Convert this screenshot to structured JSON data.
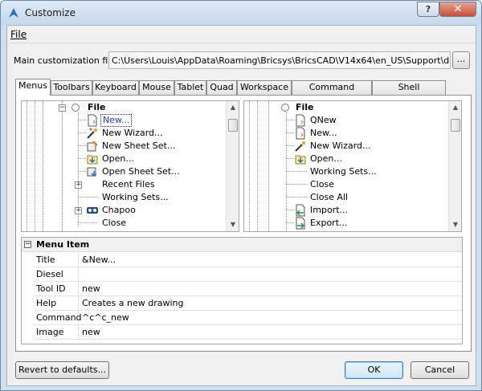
{
  "window": {
    "title": "Customize",
    "help": "?",
    "close": "✕"
  },
  "menubar": {
    "file": "File"
  },
  "main_file": {
    "label": "Main customization file:",
    "value": "C:\\Users\\Louis\\AppData\\Roaming\\Bricsys\\BricsCAD\\V14x64\\en_US\\Support\\default.cui",
    "browse": "..."
  },
  "tabs": [
    "Menus",
    "Toolbars",
    "Keyboard",
    "Mouse",
    "Tablet",
    "Quad",
    "Workspace",
    "Command Aliases",
    "Shell Commands"
  ],
  "left_tree": {
    "root": "File",
    "items": [
      "New...",
      "New Wizard...",
      "New Sheet Set...",
      "Open...",
      "Open Sheet Set...",
      "Recent Files",
      "Working Sets...",
      "Chapoo",
      "Close"
    ]
  },
  "right_tree": {
    "root": "File",
    "items": [
      "QNew",
      "New...",
      "New Wizard...",
      "Open...",
      "Working Sets...",
      "Close",
      "Close All",
      "Import...",
      "Export..."
    ]
  },
  "menu_item": {
    "header": "Menu Item",
    "rows": [
      {
        "key": "Title",
        "value": "&New..."
      },
      {
        "key": "Diesel",
        "value": ""
      },
      {
        "key": "Tool ID",
        "value": "new"
      },
      {
        "key": "Help",
        "value": "Creates a new drawing"
      },
      {
        "key": "Command",
        "value": "^c^c_new"
      },
      {
        "key": "Image",
        "value": "new"
      }
    ]
  },
  "buttons": {
    "revert": "Revert to defaults...",
    "ok": "OK",
    "cancel": "Cancel"
  }
}
